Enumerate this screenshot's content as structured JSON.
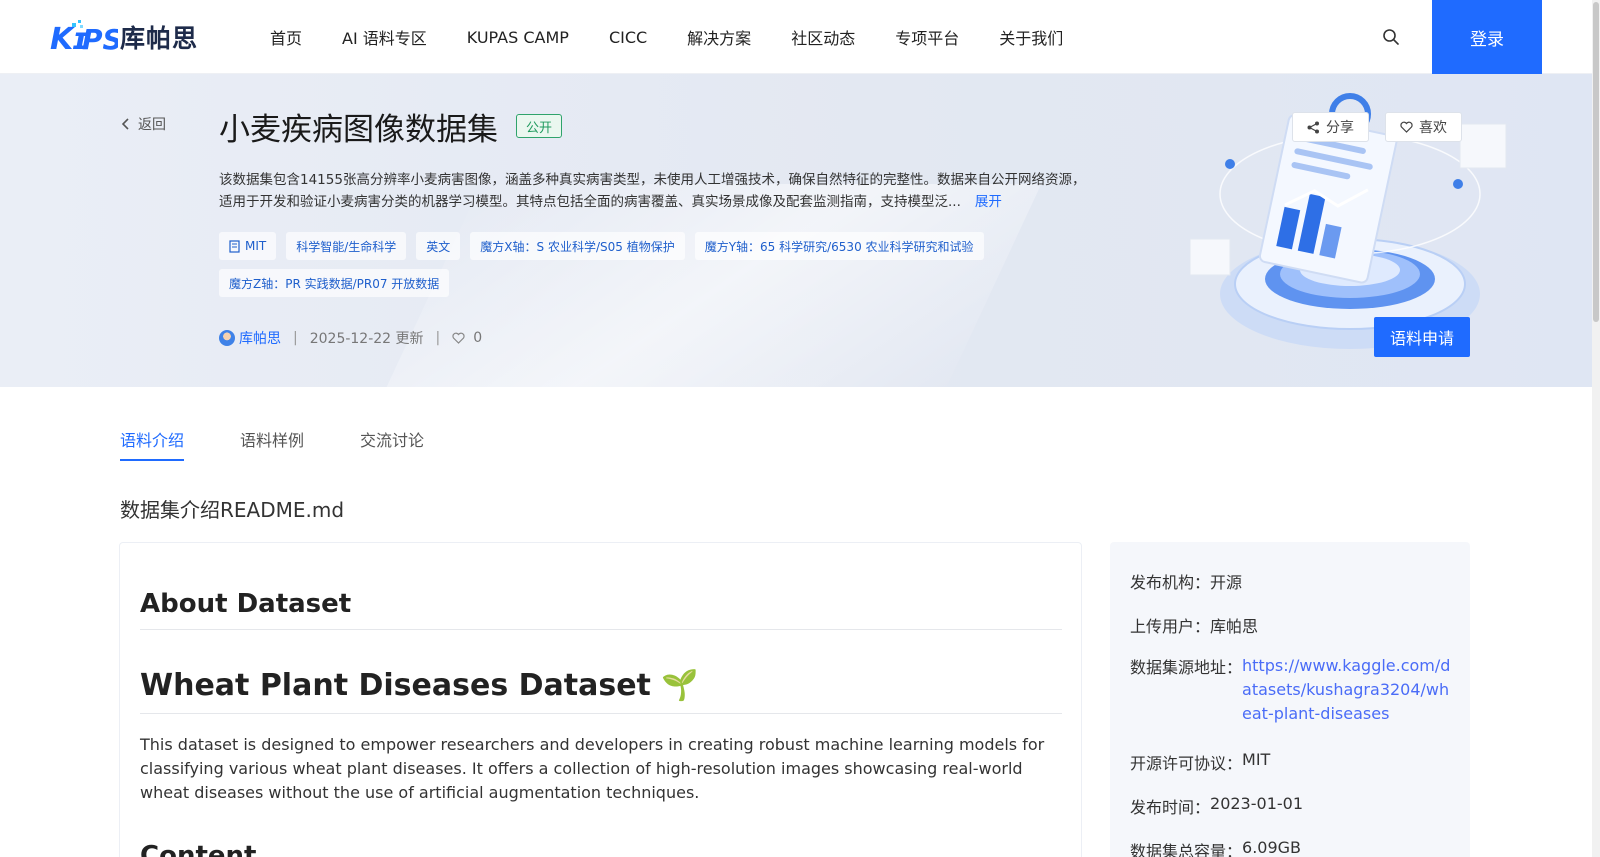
{
  "brand": {
    "logo_text": "库帕思"
  },
  "nav": {
    "items": [
      "首页",
      "AI 语料专区",
      "KUPAS CAMP",
      "CICC",
      "解决方案",
      "社区动态",
      "专项平台",
      "关于我们"
    ],
    "login": "登录"
  },
  "hero": {
    "back": "返回",
    "title": "小麦疾病图像数据集",
    "visibility": "公开",
    "description": "该数据集包含14155张高分辨率小麦病害图像，涵盖多种真实病害类型，未使用人工增强技术，确保自然特征的完整性。数据来自公开网络资源，适用于开发和验证小麦病害分类的机器学习模型。其特点包括全面的病害覆盖、真实场景成像及配套监测指南，支持模型泛...",
    "expand": "展开",
    "tags": [
      "MIT",
      "科学智能/生命科学",
      "英文",
      "魔方X轴：S 农业科学/S05 植物保护",
      "魔方Y轴：65 科学研究/6530 农业科学研究和试验",
      "魔方Z轴：PR 实践数据/PR07 开放数据"
    ],
    "author": "库帕思",
    "updated": "2025-12-22 更新",
    "likes": "0",
    "share": "分享",
    "like": "喜欢",
    "apply": "语料申请"
  },
  "tabs": [
    "语料介绍",
    "语料样例",
    "交流讨论"
  ],
  "section_title": "数据集介绍README.md",
  "readme": {
    "h1": "About Dataset",
    "h2": "Wheat Plant Diseases Dataset 🌱",
    "paragraph": "This dataset is designed to empower researchers and developers in creating robust machine learning models for classifying various wheat plant diseases. It offers a collection of high-resolution images showcasing real-world wheat diseases without the use of artificial augmentation techniques.",
    "h3": "Content"
  },
  "info": {
    "publisher_label": "发布机构：",
    "publisher": "开源",
    "uploader_label": "上传用户：",
    "uploader": "库帕思",
    "source_label": "数据集源地址：",
    "source": "https://www.kaggle.com/datasets/kushagra3204/wheat-plant-diseases",
    "license_label": "开源许可协议：",
    "license": "MIT",
    "date_label": "发布时间：",
    "date": "2023-01-01",
    "size_label": "数据集总容量：",
    "size": "6.09GB"
  },
  "colors": {
    "primary": "#1f6bff",
    "public_green": "#1f9a5e"
  }
}
